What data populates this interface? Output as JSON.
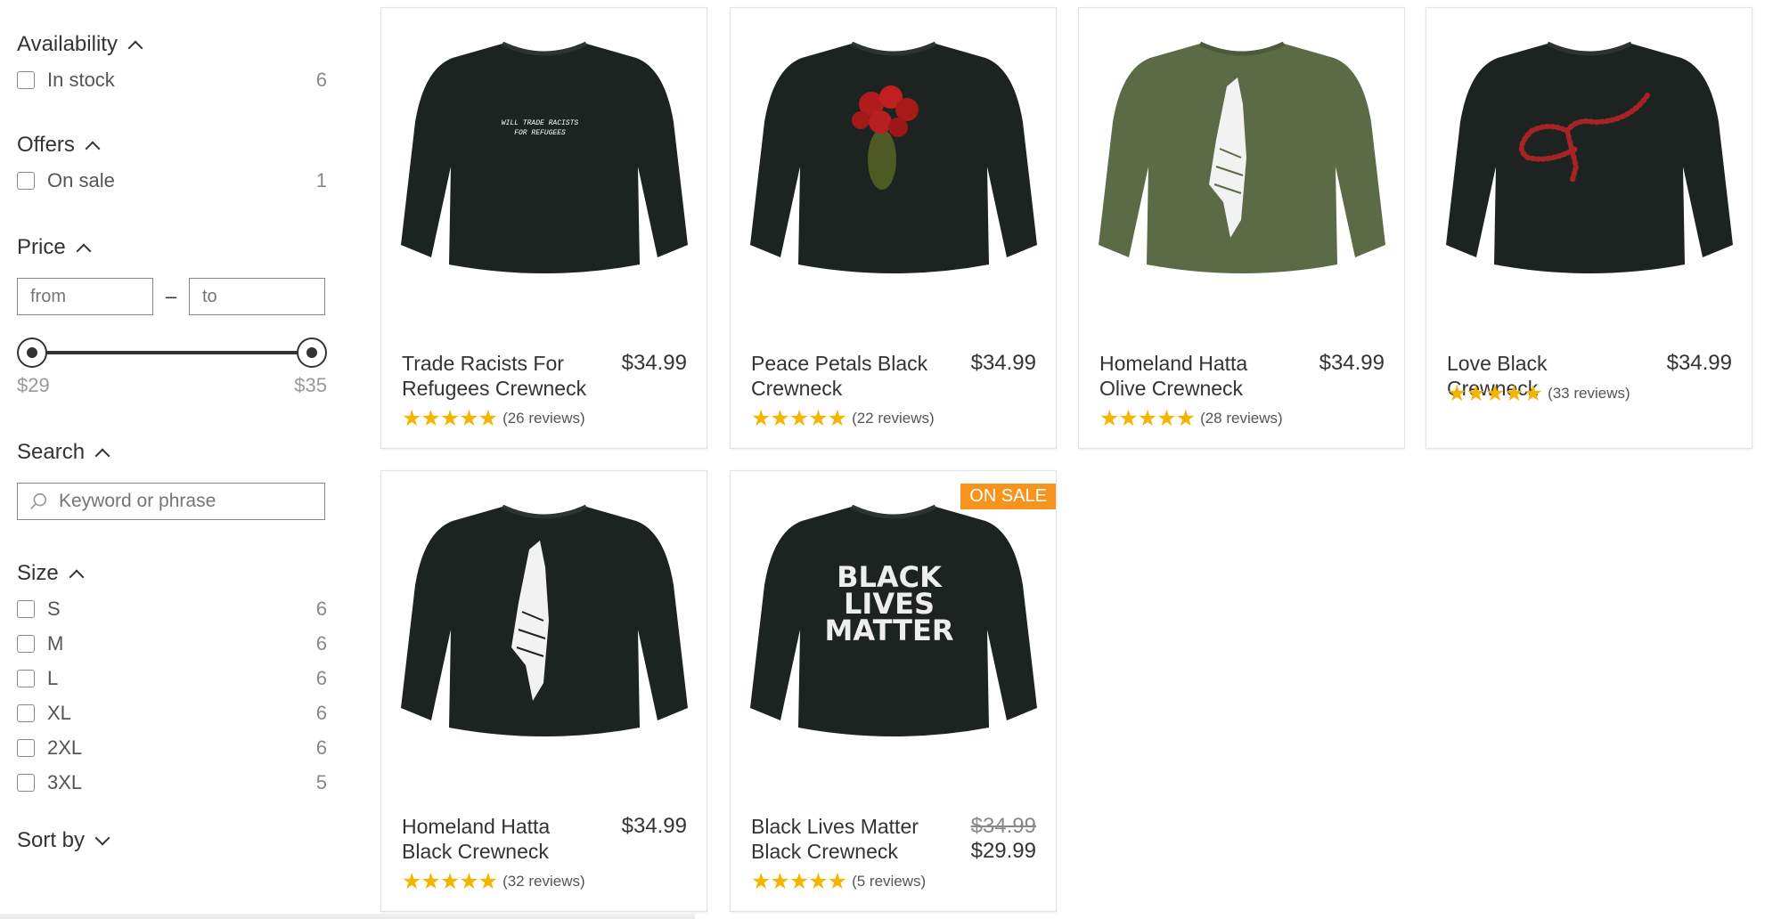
{
  "filters": {
    "availability": {
      "title": "Availability",
      "in_stock_label": "In stock",
      "in_stock_count": "6"
    },
    "offers": {
      "title": "Offers",
      "on_sale_label": "On sale",
      "on_sale_count": "1"
    },
    "price": {
      "title": "Price",
      "from_placeholder": "from",
      "to_placeholder": "to",
      "dash": "–",
      "min_label": "$29",
      "max_label": "$35"
    },
    "search": {
      "title": "Search",
      "placeholder": "Keyword or phrase"
    },
    "size": {
      "title": "Size",
      "options": [
        {
          "label": "S",
          "count": "6"
        },
        {
          "label": "M",
          "count": "6"
        },
        {
          "label": "L",
          "count": "6"
        },
        {
          "label": "XL",
          "count": "6"
        },
        {
          "label": "2XL",
          "count": "6"
        },
        {
          "label": "3XL",
          "count": "5"
        }
      ]
    },
    "sort": {
      "title": "Sort by"
    }
  },
  "products": [
    {
      "name": "Trade Racists For Refugees Crewneck",
      "price": "$34.99",
      "reviews": "(26 reviews)",
      "stars": "★★★★★",
      "print_line1": "WILL TRADE RACISTS",
      "print_line2": "FOR REFUGEES"
    },
    {
      "name": "Peace Petals Black Crewneck",
      "price": "$34.99",
      "reviews": "(22 reviews)",
      "stars": "★★★★★"
    },
    {
      "name": "Homeland Hatta Olive Crewneck",
      "price": "$34.99",
      "reviews": "(28 reviews)",
      "stars": "★★★★★"
    },
    {
      "name": "Love Black Crewneck",
      "price": "$34.99",
      "reviews": "(33 reviews)",
      "stars": "★★★★★"
    },
    {
      "name": "Homeland Hatta Black Crewneck",
      "price": "$34.99",
      "reviews": "(32 reviews)",
      "stars": "★★★★★"
    },
    {
      "name": "Black Lives Matter Black Crewneck",
      "old_price": "$34.99",
      "price": "$29.99",
      "reviews": "(5 reviews)",
      "stars": "★★★★★",
      "badge": "ON SALE",
      "print_line1": "BLACK",
      "print_line2": "LIVES",
      "print_line3": "MATTER"
    }
  ],
  "colors": {
    "sweater_black": "#1d2321",
    "sweater_olive": "#5a6b45",
    "badge": "#f7941d",
    "star": "#f5b400"
  }
}
